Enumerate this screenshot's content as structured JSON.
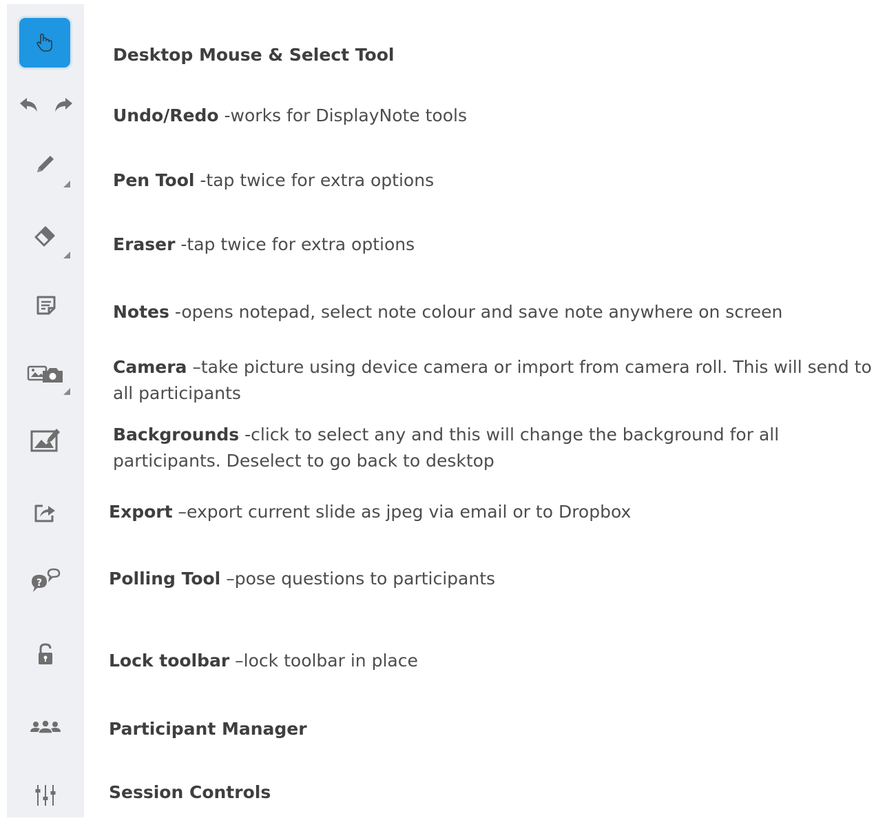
{
  "tools": [
    {
      "id": "select",
      "icon": "hand-pointer-icon",
      "label": "Desktop Mouse & Select Tool",
      "desc": ""
    },
    {
      "id": "undo-redo",
      "icon": "undo-redo-icon",
      "label": "Undo/Redo",
      "desc": " -works for DisplayNote tools"
    },
    {
      "id": "pen",
      "icon": "pen-icon",
      "label": "Pen Tool",
      "desc": " -tap twice for extra options"
    },
    {
      "id": "eraser",
      "icon": "eraser-icon",
      "label": "Eraser",
      "desc": " -tap twice for extra options"
    },
    {
      "id": "notes",
      "icon": "note-icon",
      "label": "Notes",
      "desc": " -opens notepad, select note colour and save note anywhere on screen"
    },
    {
      "id": "camera",
      "icon": "camera-icon",
      "label": "Camera",
      "desc": " –take picture using device camera or import from camera roll.  This will send to",
      "desc2": "all participants"
    },
    {
      "id": "backgrounds",
      "icon": "background-image-icon",
      "label": "Backgrounds",
      "desc": " -click to select any and this will change the background for all",
      "desc2": "participants.  Deselect to go back to desktop"
    },
    {
      "id": "export",
      "icon": "export-icon",
      "label": "Export",
      "desc": " –export current slide as jpeg via email or to Dropbox"
    },
    {
      "id": "polling",
      "icon": "poll-question-icon",
      "label": "Polling Tool",
      "desc": " –pose questions to participants"
    },
    {
      "id": "lock",
      "icon": "unlock-icon",
      "label": "Lock toolbar",
      "desc": " –lock toolbar in place"
    },
    {
      "id": "participants",
      "icon": "participants-icon",
      "label": "Participant Manager",
      "desc": ""
    },
    {
      "id": "session",
      "icon": "sliders-icon",
      "label": "Session Controls",
      "desc": ""
    }
  ],
  "colors": {
    "toolbar_bg": "#eff0f3",
    "accent": "#1e96e1",
    "icon": "#6f6f6f",
    "text": "#4d4d4d"
  }
}
